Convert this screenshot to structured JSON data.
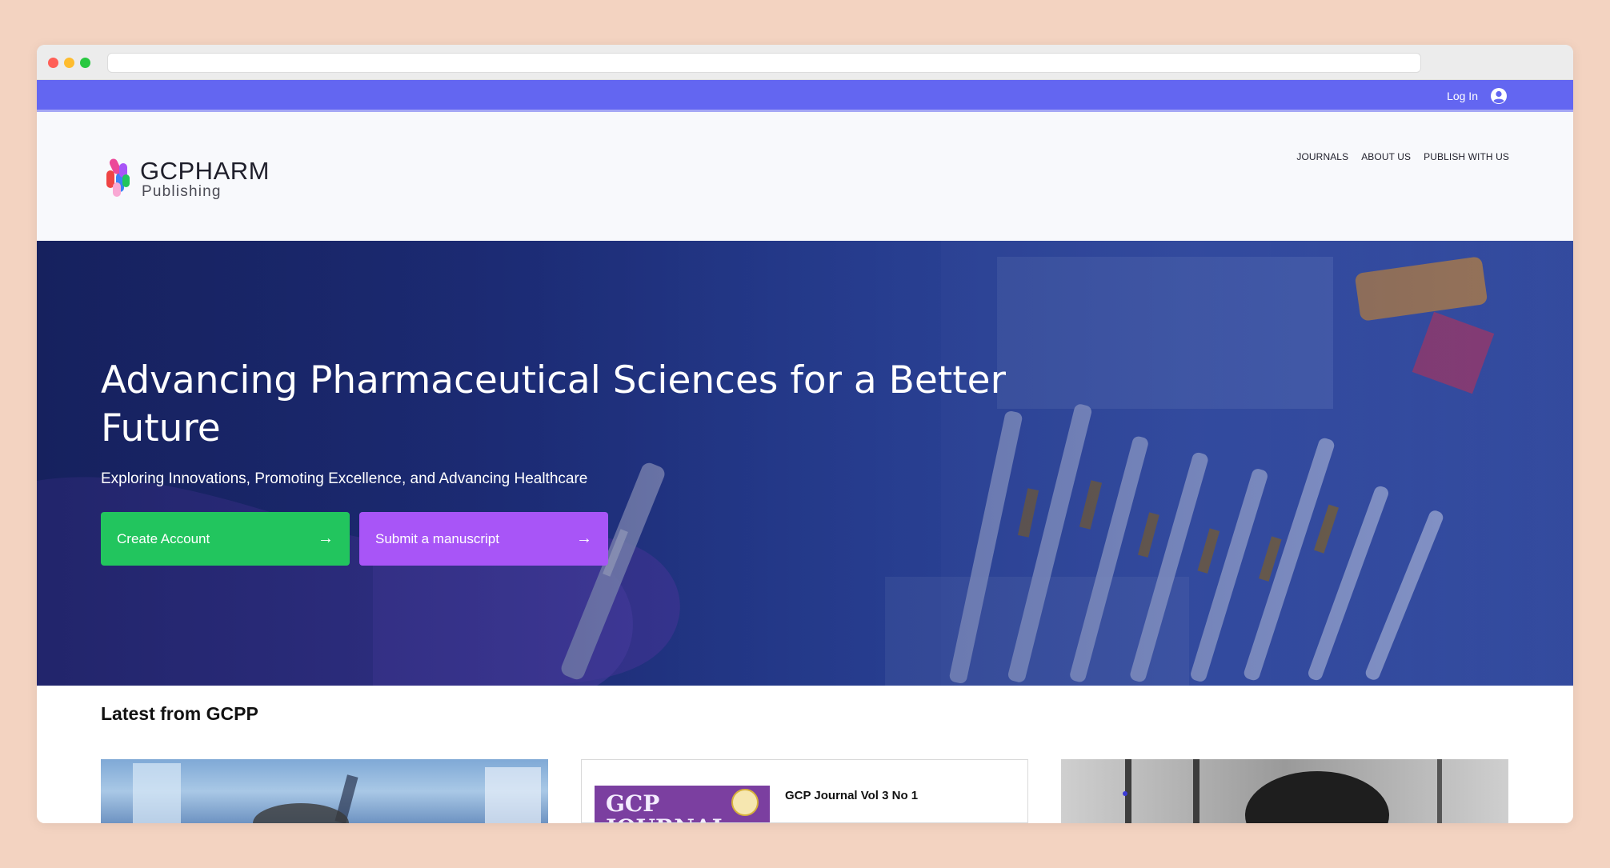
{
  "topbar": {
    "login_label": "Log In"
  },
  "brand": {
    "name": "GCPHARM",
    "tagline": "Publishing"
  },
  "nav": {
    "items": [
      "JOURNALS",
      "ABOUT US",
      "PUBLISH WITH US"
    ]
  },
  "hero": {
    "title": "Advancing Pharmaceutical Sciences for a Better Future",
    "subtitle": "Exploring Innovations, Promoting Excellence, and Advancing Healthcare",
    "primary_button": "Create Account",
    "secondary_button": "Submit a manuscript",
    "arrow": "→"
  },
  "latest": {
    "title": "Latest from GCPP",
    "cards": [
      {
        "title": ""
      },
      {
        "title": "GCP Journal Vol 3 No 1",
        "cover_text": "GCP JOURNAL"
      },
      {
        "title": ""
      }
    ]
  },
  "colors": {
    "topbar": "#6366f1",
    "primary_button": "#22c55e",
    "secondary_button": "#a855f7"
  }
}
